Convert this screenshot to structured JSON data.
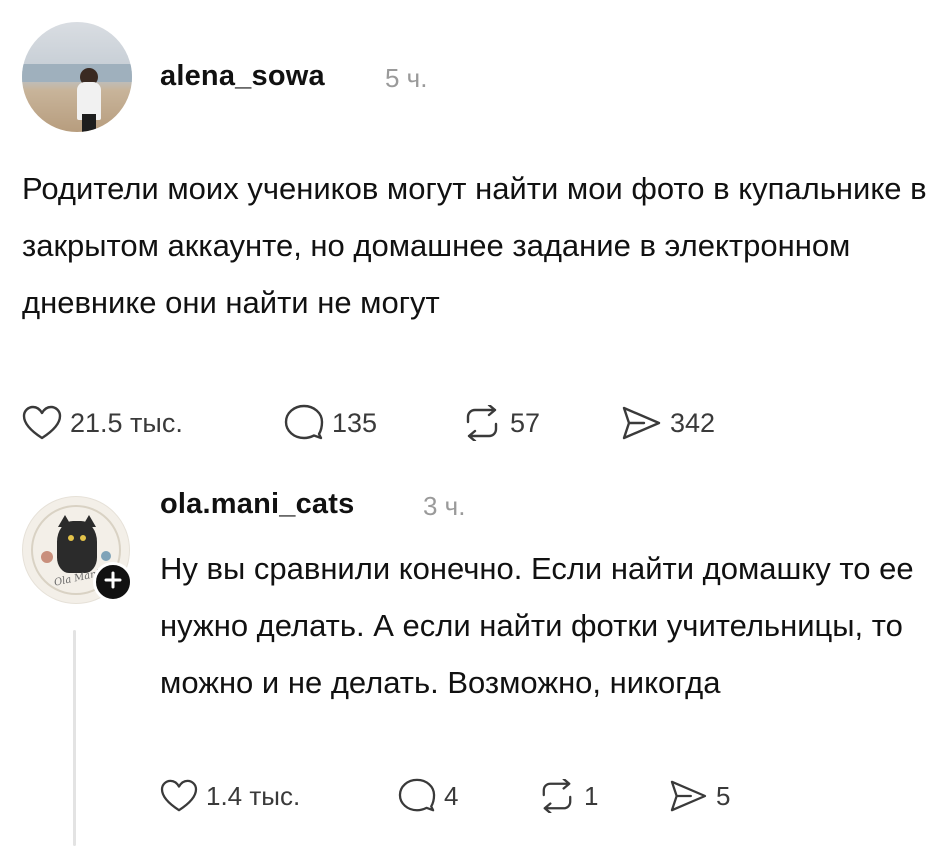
{
  "post": {
    "username": "alena_sowa",
    "time": "5 ч.",
    "text": "Родители моих учеников могут найти мои фото в купальнике в закрытом аккаунте, но домашнее задание в электронном дневнике они найти не могут",
    "likes": "21.5 тыс.",
    "comments": "135",
    "reposts": "57",
    "shares": "342"
  },
  "reply": {
    "username": "ola.mani_cats",
    "time": "3 ч.",
    "avatar_text": "Ola Mani",
    "text": "Ну вы сравнили конечно. Если найти домашку то ее нужно делать. А если найти фотки учительницы, то можно и не делать. Возможно, никогда",
    "likes": "1.4 тыс.",
    "comments": "4",
    "reposts": "1",
    "shares": "5"
  },
  "icons": {
    "like": "heart-icon",
    "comment": "comment-bubble-icon",
    "repost": "repost-arrows-icon",
    "share": "send-arrow-icon",
    "follow": "plus-icon"
  },
  "colors": {
    "text": "#111111",
    "muted": "#9a9a9a",
    "icon": "#3a3a3a",
    "thread_line": "#e3e3e3",
    "follow_badge": "#111111"
  }
}
